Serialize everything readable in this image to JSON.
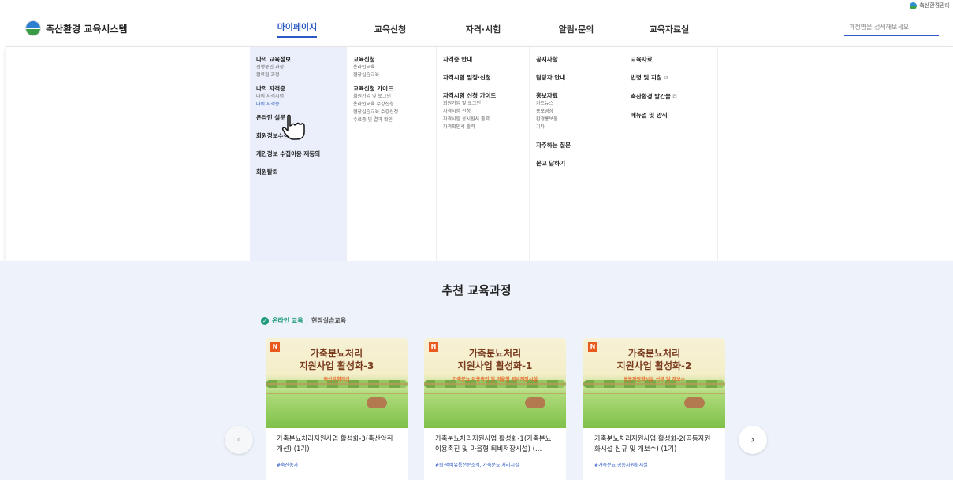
{
  "util": {
    "label": "축산환경관리"
  },
  "logo": {
    "text": "축산환경 교육시스템"
  },
  "gnb": [
    {
      "label": "마이페이지",
      "active": true
    },
    {
      "label": "교육신청"
    },
    {
      "label": "자격·시험"
    },
    {
      "label": "알림·문의"
    },
    {
      "label": "교육자료실"
    }
  ],
  "search": {
    "placeholder": "과정명을 검색해보세요."
  },
  "menu": {
    "mypage": {
      "g1": "나의 교육정보",
      "g1s1": "진행중인 과정",
      "g1s2": "완료된 과정",
      "g2": "나의 자격증",
      "g2s1": "나의 자격시험",
      "g2s2": "나의 자격증",
      "g3": "온라인 설문",
      "g4": "회원정보수정",
      "g5": "개인정보 수집이용 재동의",
      "g6": "회원탈퇴"
    },
    "apply": {
      "g1": "교육신청",
      "g1s1": "온라인교육",
      "g1s2": "현장실습교육",
      "g2": "교육신청 가이드",
      "g2s1": "회원가입 및 로그인",
      "g2s2": "온라인교육 수강신청",
      "g2s3": "현장실습교육 수강신청",
      "g2s4": "수료증 및 결과 확인"
    },
    "exam": {
      "g1": "자격증 안내",
      "g2": "자격시험 일정·신청",
      "g3": "자격시험 신청 가이드",
      "g3s1": "회원가입 및 로그인",
      "g3s2": "자격시험 신청",
      "g3s3": "자격시험 응시원서 출력",
      "g3s4": "자격확인서 출력"
    },
    "notice": {
      "g1": "공지사항",
      "g2": "담당자 안내",
      "g3": "홍보자료",
      "g3s1": "카드뉴스",
      "g3s2": "홍보영상",
      "g3s3": "환경홍보물",
      "g3s4": "기타",
      "g4": "자주하는 질문",
      "g5": "묻고 답하기"
    },
    "library": {
      "g1": "교육자료",
      "g2": "법령 및 지침",
      "g3": "축산환경 발간물",
      "g4": "메뉴얼 및 양식"
    }
  },
  "recommend": {
    "title": "추천 교육과정",
    "tab_online": "온라인 교육",
    "tab_field": "현장실습교육",
    "cards": [
      {
        "badge": "N",
        "thumb_title1": "가축분뇨처리",
        "thumb_title2": "지원사업 활성화-3",
        "thumb_sub": "축산악취개선",
        "name": "가축분뇨처리지원사업 활성화-3(축산악취개선) (1기)",
        "tags": "#축산농가"
      },
      {
        "badge": "N",
        "thumb_title1": "가축분뇨처리",
        "thumb_title2": "지원사업 활성화-1",
        "thumb_sub": "가축분뇨 이용촉진 및 마을형 퇴비저장시설",
        "name": "가축분뇨처리지원사업 활성화-1(가축분뇨이용촉진 및 마을형 퇴비저장시설) (…",
        "tags": "#퇴·액비유통전문조직, 가축분뇨 처리시설"
      },
      {
        "badge": "N",
        "thumb_title1": "가축분뇨처리",
        "thumb_title2": "지원사업 활성화-2",
        "thumb_sub": "공동자원화시설 신규 및 개보수",
        "name": "가축분뇨처리지원사업 활성화-2(공동자원화시설 신규 및 개보수) (1기)",
        "tags": "#가축분뇨 공동자원화시설"
      }
    ],
    "prev": "‹",
    "next": "›"
  }
}
